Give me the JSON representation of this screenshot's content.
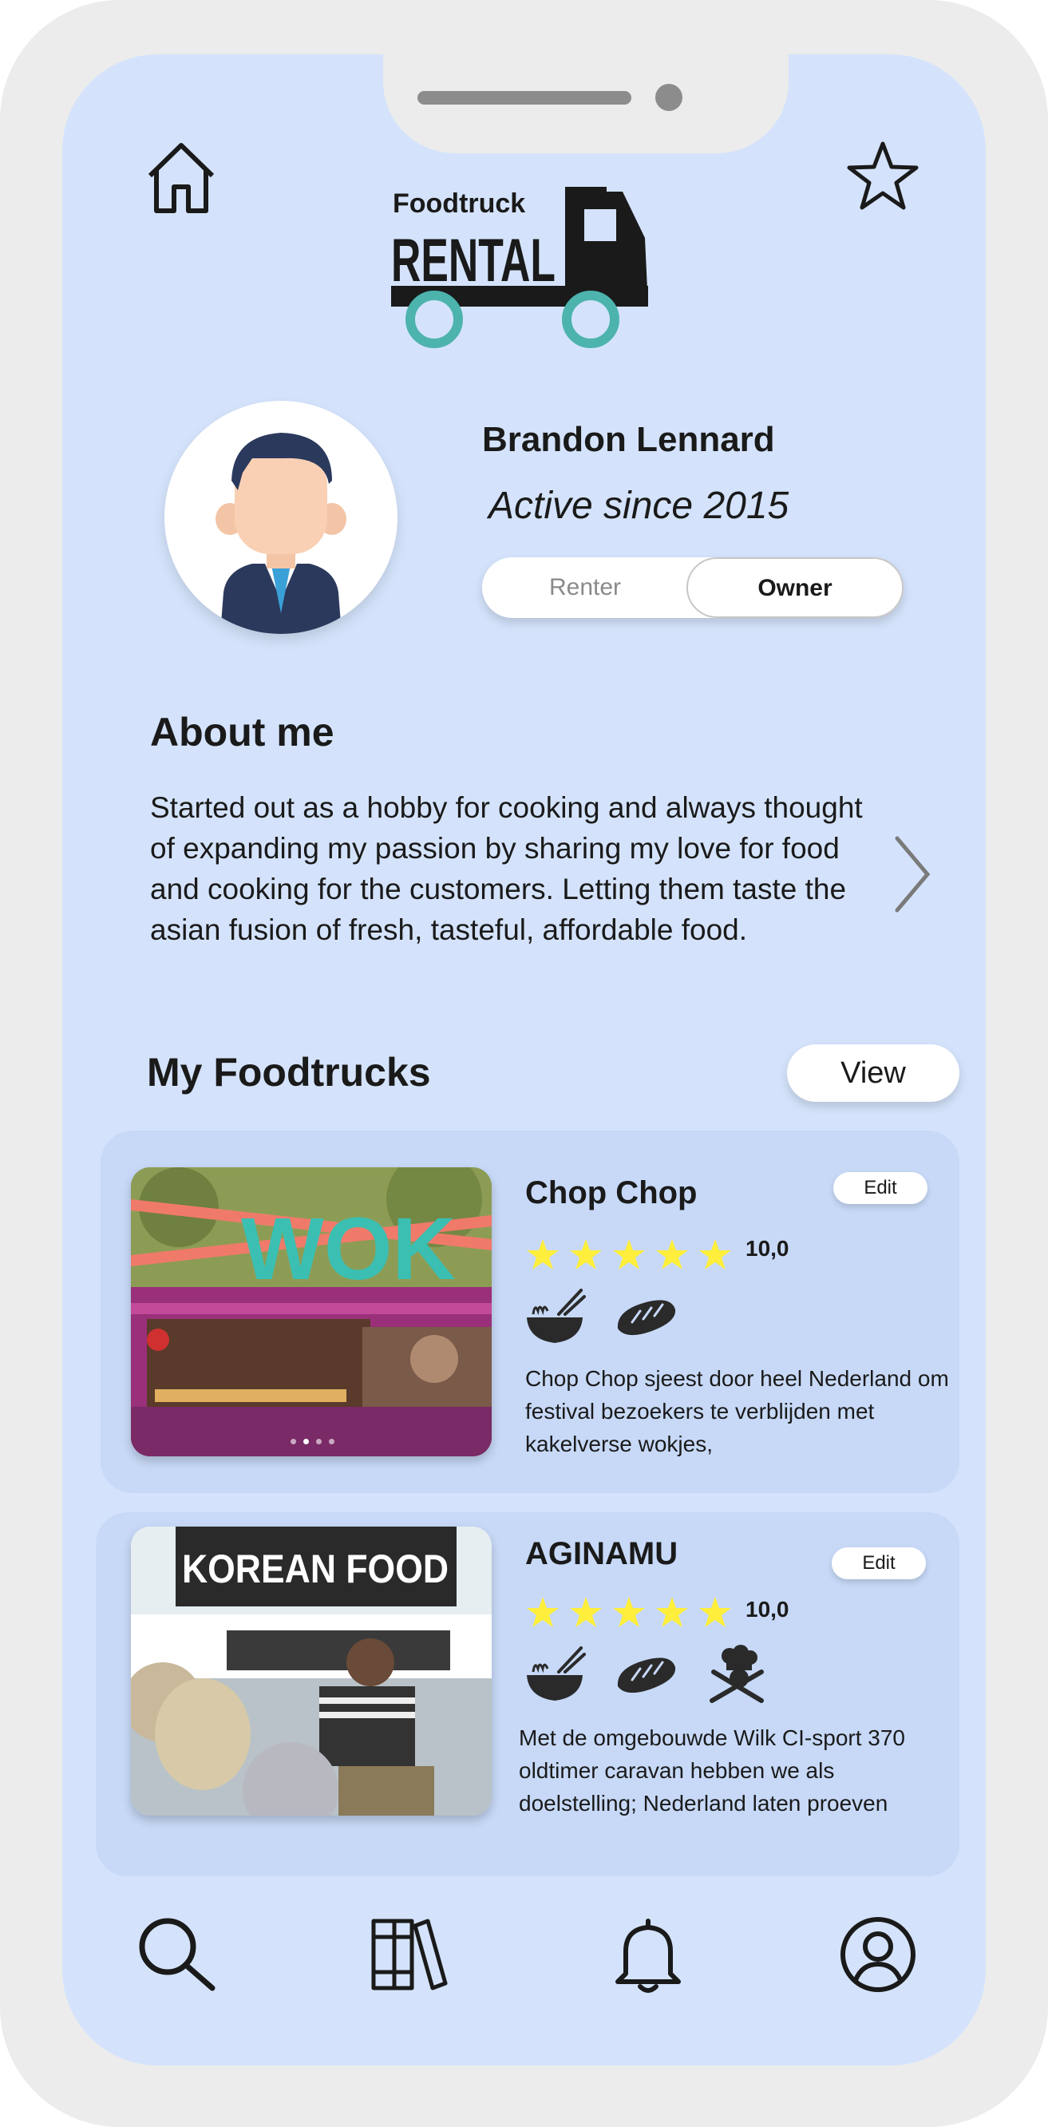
{
  "app": {
    "logo_text_top": "Foodtruck",
    "logo_text_bottom": "RENTAL",
    "logo_teal": "#4db3ad"
  },
  "header": {
    "home_icon": "home-icon",
    "favorite_icon": "star-icon"
  },
  "profile": {
    "name": "Brandon Lennard",
    "since": "Active since 2015",
    "role_toggle": {
      "options": [
        "Renter",
        "Owner"
      ],
      "selected": "Owner"
    }
  },
  "about": {
    "title": "About me",
    "text": "Started out as a hobby for cooking and always thought of expanding my passion by sharing my love for food and cooking for the customers. Letting them taste the asian fusion of fresh, tasteful, affordable food."
  },
  "foodtrucks": {
    "title": "My Foodtrucks",
    "view_label": "View",
    "items": [
      {
        "name": "Chop Chop",
        "edit_label": "Edit",
        "stars": 5,
        "rating": "10,0",
        "image_sign": "WOK",
        "cuisines": [
          "noodle-bowl-icon",
          "bread-icon"
        ],
        "description": "Chop Chop sjeest door heel Nederland om festival bezoekers te verblijden met kakelverse wokjes,"
      },
      {
        "name": "AGINAMU",
        "edit_label": "Edit",
        "stars": 5,
        "rating": "10,0",
        "image_sign": "KOREAN FOOD",
        "cuisines": [
          "noodle-bowl-icon",
          "bread-icon",
          "chef-icon"
        ],
        "description": "Met de omgebouwde Wilk CI-sport 370 oldtimer caravan hebben we als doelstelling; Nederland laten proeven"
      }
    ]
  },
  "nav": {
    "items": [
      "search-icon",
      "library-icon",
      "notifications-icon",
      "profile-icon"
    ]
  },
  "colors": {
    "screen_bg": "#d4e3fb",
    "card_bg": "#c7d9f7",
    "star": "#ffef3c",
    "text": "#1a1a1a"
  }
}
